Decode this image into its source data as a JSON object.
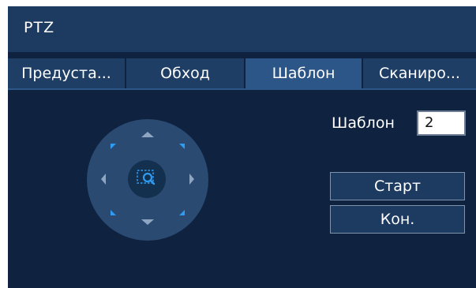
{
  "window": {
    "title": "PTZ"
  },
  "tabs": [
    {
      "label": "Предуста..."
    },
    {
      "label": "Обход"
    },
    {
      "label": "Шаблон"
    },
    {
      "label": "Сканиро..."
    }
  ],
  "active_tab": "Шаблон",
  "pattern": {
    "label": "Шаблон",
    "value": "2"
  },
  "buttons": {
    "start": "Старт",
    "end": "Кон."
  },
  "icons": {
    "ptz_center": "zoom-region-icon",
    "directions": [
      "up-arrow-icon",
      "down-arrow-icon",
      "left-arrow-icon",
      "right-arrow-icon",
      "up-left-arrow-icon",
      "up-right-arrow-icon",
      "down-left-arrow-icon",
      "down-right-arrow-icon"
    ]
  },
  "colors": {
    "background": "#0f2340",
    "titlebar": "#1d3b60",
    "tab": "#1f3e66",
    "tab_active": "#2c5588",
    "accent": "#2f9cf4"
  }
}
